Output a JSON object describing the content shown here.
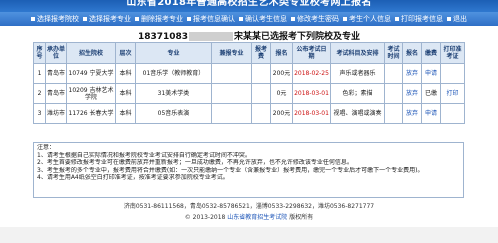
{
  "banner": {
    "title": "山东省2018年普通高校招生艺术类专业校考网上报名"
  },
  "nav": {
    "items": [
      "选择报考院校",
      "选择报考专业",
      "删除报考专业",
      "报考信息确认",
      "确认考生信息",
      "修改考生密码",
      "考生个人信息",
      "打印报考信息",
      "退出"
    ]
  },
  "registration": {
    "id_prefix": "18371083",
    "id_suffix": "宋某某已选报考下列院校及专业"
  },
  "table": {
    "headers": [
      "序号",
      "承办单位",
      "招生院校",
      "层次",
      "专业",
      "兼报专业",
      "报考费",
      "报名",
      "公布考试日期",
      "考试科目及安排",
      "考试时间",
      "报名",
      "缴费",
      "打印准考证"
    ],
    "rows": [
      {
        "no": "1",
        "city": "青岛市",
        "school": "10749 宁夏大学",
        "level": "本科",
        "major": "01音乐学（教师教育）",
        "sub": "",
        "fee": "",
        "cost": "200元",
        "date": "2018-02-25",
        "subject": "声乐或者器乐",
        "time": "",
        "apply": "放弃",
        "pay": "申请",
        "print": ""
      },
      {
        "no": "2",
        "city": "青岛市",
        "school": "10209 吉林艺术学院",
        "level": "本科",
        "major": "31美术学类",
        "sub": "",
        "fee": "",
        "cost": "0元",
        "date": "2018-03-01",
        "subject": "色彩；素描",
        "time": "",
        "apply": "放弃",
        "pay": "已缴",
        "print": "打印"
      },
      {
        "no": "3",
        "city": "潍坊市",
        "school": "11726 长春大学",
        "level": "本科",
        "major": "05音乐表演",
        "sub": "",
        "fee": "",
        "cost": "200元",
        "date": "2018-03-01",
        "subject": "视唱、演唱或演奏",
        "time": "",
        "apply": "放弃",
        "pay": "申请",
        "print": ""
      }
    ]
  },
  "tips": [
    "注意：",
    "1、请考生根据自己实际情况和报考院校专业考试安排自行确定考试时间不冲突。",
    "2、考生首要修改报考专业可在缴费前放弃并重新报考；一旦成功缴费，不再允许放弃，也不允许修改该专业任何信息。",
    "3、考生报考的多个专业中，报考费用将合并缴费(如：一次只能缴纳一个专业（含兼报专业）报考费用，缴完一个专业后才可缴下一个专业费用)。",
    "4、请考生用A4纸张空白打印准考证，按准考证要求参加院校专业考试。"
  ],
  "footer": {
    "contacts": "济南0531-86111568，青岛0532-85786521，淄博0533-2298632，潍坊0536-8271777",
    "copyright": "© 2013-2018",
    "org": "山东省教育招生考试院",
    "rights": "版权所有"
  },
  "colors": {
    "banner": "#1c5fb5",
    "nav": "#2f6fc6",
    "header_bg": "#dce7f4",
    "link": "#1d56b8",
    "red": "#cc1111"
  }
}
